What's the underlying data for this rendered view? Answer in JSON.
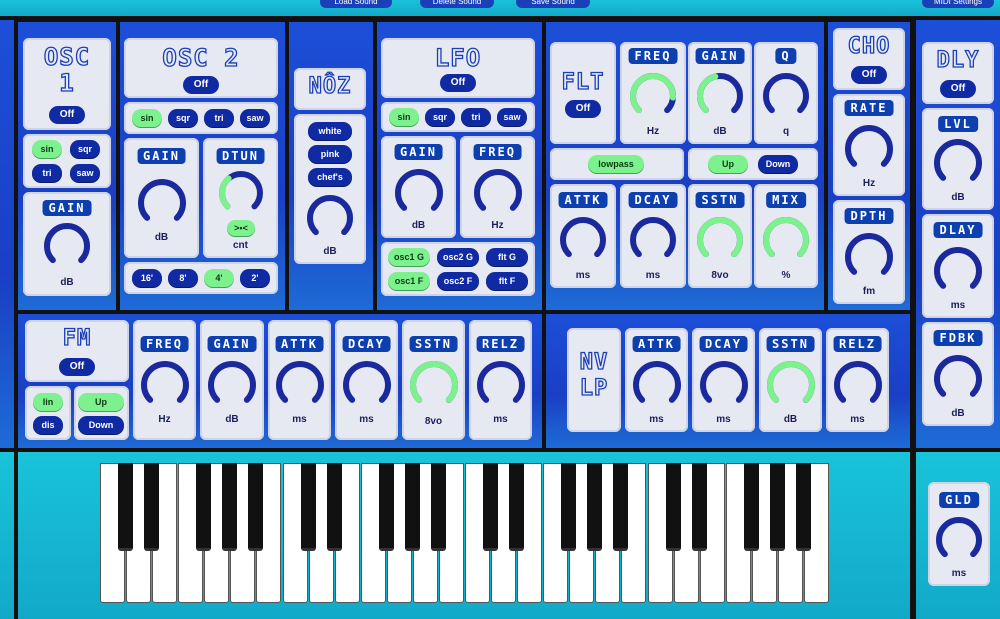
{
  "top_bar": {
    "load_label": "Load Sound",
    "delete_label": "Delete Sound",
    "save_label": "Save Sound",
    "midi_label": "MIDI Settings"
  },
  "osc1": {
    "title": "OSC\n1",
    "power": "Off",
    "waves": [
      "sin",
      "sqr",
      "tri",
      "saw"
    ],
    "active_wave": "sin",
    "gain": {
      "label": "GAIN",
      "unit": "dB"
    }
  },
  "osc2": {
    "title": "OSC 2",
    "power": "Off",
    "waves": [
      "sin",
      "sqr",
      "tri",
      "saw"
    ],
    "active_wave": "sin",
    "gain": {
      "label": "GAIN",
      "unit": "dB"
    },
    "detune": {
      "label": "DTUN",
      "unit": "cnt",
      "reset": ">•<"
    },
    "octaves": [
      "16'",
      "8'",
      "4'",
      "2'"
    ],
    "active_octave": "4'"
  },
  "noise": {
    "title": "NÔZ",
    "types": [
      "white",
      "pink",
      "chef's"
    ],
    "unit": "dB"
  },
  "lfo": {
    "title": "LFO",
    "power": "Off",
    "waves": [
      "sin",
      "sqr",
      "tri",
      "saw"
    ],
    "active_wave": "sin",
    "gain": {
      "label": "GAIN",
      "unit": "dB"
    },
    "freq": {
      "label": "FREQ",
      "unit": "Hz"
    },
    "targets": [
      "osc1 G",
      "osc2 G",
      "flt G",
      "osc1 F",
      "osc2 F",
      "flt F"
    ],
    "active_targets": [
      "osc1 G",
      "osc1 F"
    ]
  },
  "filter": {
    "title": "FLT",
    "power": "Off",
    "freq": {
      "label": "FREQ",
      "unit": "Hz"
    },
    "gain": {
      "label": "GAIN",
      "unit": "dB"
    },
    "q": {
      "label": "Q",
      "unit": "q"
    },
    "type": "lowpass",
    "dir_up": "Up",
    "dir_down": "Down",
    "attack": {
      "label": "ATTK",
      "unit": "ms"
    },
    "decay": {
      "label": "DCAY",
      "unit": "ms"
    },
    "sustain": {
      "label": "SSTN",
      "unit": "8vo"
    },
    "mix": {
      "label": "MIX",
      "unit": "%"
    }
  },
  "chorus": {
    "title": "CHO",
    "power": "Off",
    "rate": {
      "label": "RATE",
      "unit": "Hz"
    },
    "depth": {
      "label": "DPTH",
      "unit": "fm"
    }
  },
  "delay": {
    "title": "DLY",
    "power": "Off",
    "level": {
      "label": "LVL",
      "unit": "dB"
    },
    "delay": {
      "label": "DLAY",
      "unit": "ms"
    },
    "feedback": {
      "label": "FDBK",
      "unit": "dB"
    }
  },
  "fm": {
    "title": "FM",
    "power": "Off",
    "modes": [
      "lin",
      "dis"
    ],
    "active_mode": "lin",
    "dir_up": "Up",
    "dir_down": "Down",
    "freq": {
      "label": "FREQ",
      "unit": "Hz"
    },
    "gain": {
      "label": "GAIN",
      "unit": "dB"
    },
    "attack": {
      "label": "ATTK",
      "unit": "ms"
    },
    "decay": {
      "label": "DCAY",
      "unit": "ms"
    },
    "sustain": {
      "label": "SSTN",
      "unit": "8vo"
    },
    "release": {
      "label": "RELZ",
      "unit": "ms"
    }
  },
  "envelope": {
    "title": "NV\nLP",
    "attack": {
      "label": "ATTK",
      "unit": "ms"
    },
    "decay": {
      "label": "DCAY",
      "unit": "ms"
    },
    "sustain": {
      "label": "SSTN",
      "unit": "dB"
    },
    "release": {
      "label": "RELZ",
      "unit": "ms"
    }
  },
  "glide": {
    "title": "GLD",
    "unit": "ms"
  },
  "colors": {
    "panel": "#1c4fd8",
    "card": "#e7e9f2",
    "knob": "#1a2a9c",
    "knob_active": "#7ef18f",
    "button": "#0f2aa3",
    "button_on": "#7ef18f"
  }
}
